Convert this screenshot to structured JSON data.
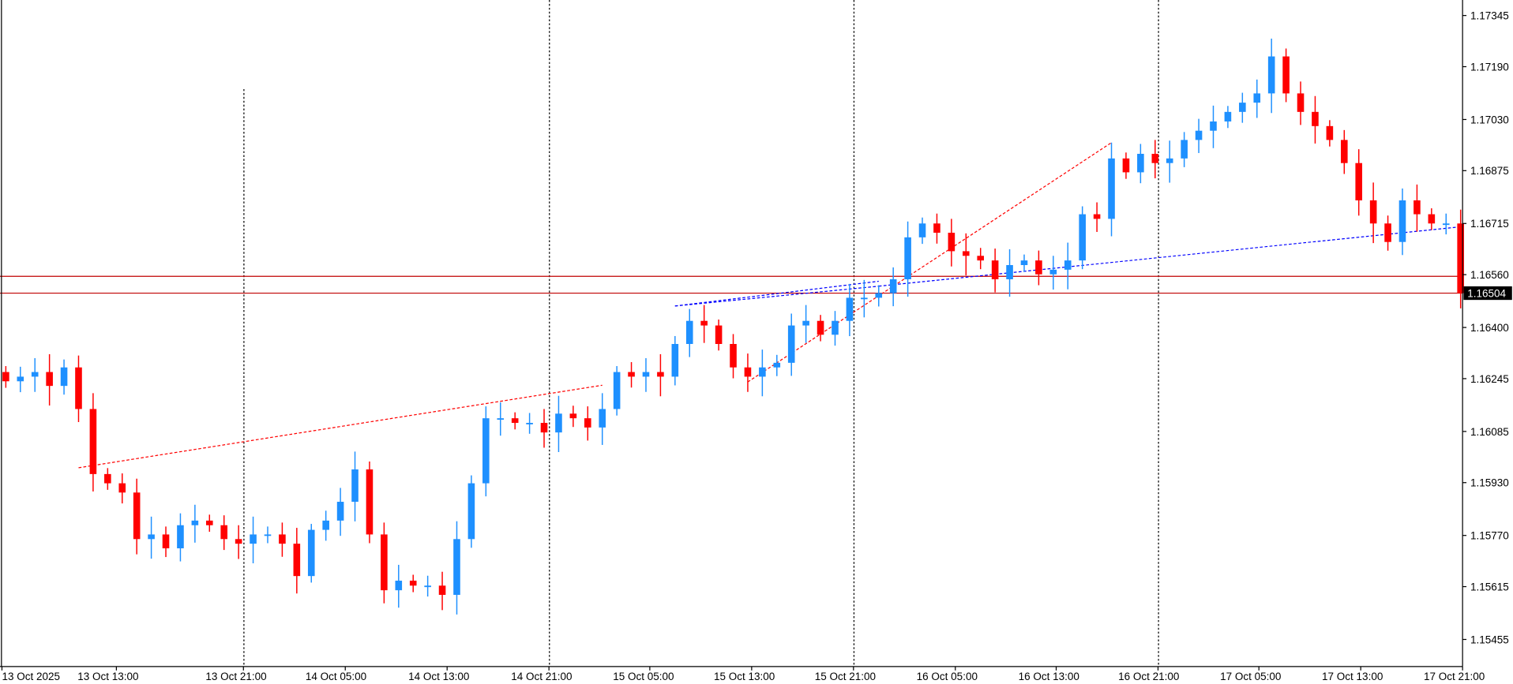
{
  "chart_data": {
    "type": "candlestick",
    "symbol_note": "",
    "ylim": [
      1.15375,
      1.174
    ],
    "y_ticks": [
      "1.17345",
      "1.17190",
      "1.17030",
      "1.16875",
      "1.16715",
      "1.16560",
      "1.16400",
      "1.16245",
      "1.16085",
      "1.15930",
      "1.15770",
      "1.15615",
      "1.15455"
    ],
    "x_ticks": [
      "13 Oct 2025",
      "13 Oct 13:00",
      "13 Oct 21:00",
      "14 Oct 05:00",
      "14 Oct 13:00",
      "14 Oct 21:00",
      "15 Oct 05:00",
      "15 Oct 13:00",
      "15 Oct 21:00",
      "16 Oct 05:00",
      "16 Oct 13:00",
      "16 Oct 21:00",
      "17 Oct 05:00",
      "17 Oct 13:00",
      "17 Oct 21:00"
    ],
    "period_separators_after_ticks": [
      "13 Oct 21:00",
      "14 Oct 21:00",
      "15 Oct 21:00",
      "16 Oct 21:00"
    ],
    "first_open": 1.16265,
    "closes": [
      1.16237,
      1.16251,
      1.16265,
      1.16223,
      1.16279,
      1.16153,
      1.15956,
      1.15928,
      1.159,
      1.15759,
      1.15773,
      1.15731,
      1.15801,
      1.15815,
      1.15801,
      1.15759,
      1.15745,
      1.15773,
      1.15773,
      1.15745,
      1.15647,
      1.15787,
      1.15815,
      1.15872,
      1.1597,
      1.15773,
      1.15604,
      1.15633,
      1.15618,
      1.15618,
      1.1559,
      1.15759,
      1.15928,
      1.16125,
      1.16125,
      1.16111,
      1.16111,
      1.16082,
      1.16139,
      1.16125,
      1.16097,
      1.16153,
      1.16265,
      1.16251,
      1.16265,
      1.16251,
      1.1635,
      1.1642,
      1.16406,
      1.1635,
      1.16279,
      1.16251,
      1.16279,
      1.16293,
      1.16406,
      1.1642,
      1.16378,
      1.1642,
      1.1649,
      1.1649,
      1.16504,
      1.16546,
      1.16673,
      1.16715,
      1.16687,
      1.16631,
      1.16617,
      1.16603,
      1.16546,
      1.16589,
      1.16603,
      1.16561,
      1.16575,
      1.16603,
      1.16743,
      1.16729,
      1.16912,
      1.1687,
      1.16926,
      1.16898,
      1.16912,
      1.16968,
      1.16996,
      1.17024,
      1.17053,
      1.17081,
      1.17109,
      1.17221,
      1.17109,
      1.17053,
      1.1701,
      1.16968,
      1.16898,
      1.16785,
      1.16715,
      1.16659,
      1.16785,
      1.16743,
      1.16715,
      1.16715,
      1.16504
    ],
    "bull_color": "#1e90ff",
    "bear_color": "#ff0000",
    "horizontal_lines": [
      {
        "price": 1.16555,
        "color": "#c00000"
      },
      {
        "price": 1.16504,
        "color": "#c00000"
      }
    ],
    "trend_lines": [
      {
        "from": [
          5,
          1.15975
        ],
        "to": [
          41,
          1.16225
        ],
        "color": "#ff0000"
      },
      {
        "from": [
          51,
          1.16235
        ],
        "to": [
          76,
          1.1696
        ],
        "color": "#ff0000"
      },
      {
        "from": [
          46,
          1.16465
        ],
        "to": [
          60,
          1.16525
        ],
        "color": "#0000ff"
      },
      {
        "from": [
          46,
          1.16465
        ],
        "to": [
          60,
          1.1654
        ],
        "color": "#0000ff"
      },
      {
        "from": [
          60,
          1.16525
        ],
        "to": [
          100,
          1.16705
        ],
        "color": "#0000ff"
      }
    ],
    "current_price": "1.16504"
  }
}
